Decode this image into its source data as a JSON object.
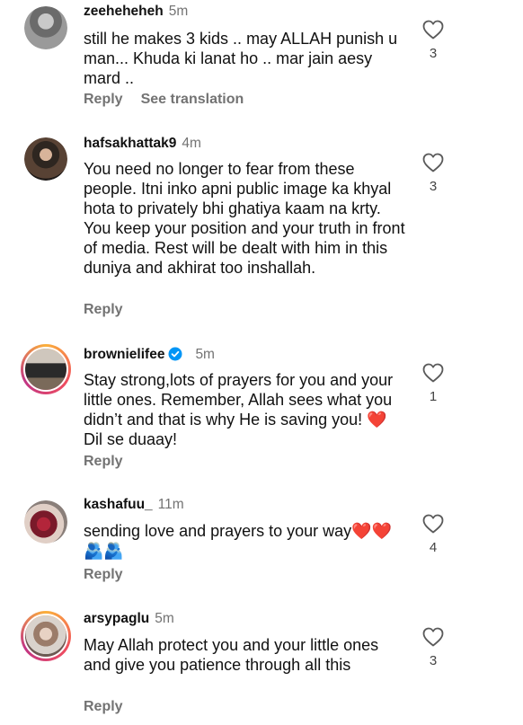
{
  "comments": [
    {
      "username": "zeeheheheh",
      "time": "5m",
      "text": "still he makes 3 kids .. may ALLAH punish u man... Khuda ki lanat ho .. mar jain aesy mard ..",
      "reply_label": "Reply",
      "translation_label": "See translation",
      "likes": "3"
    },
    {
      "username": "hafsakhattak9",
      "time": "4m",
      "text": "You need no longer to fear from these people. Itni inko apni public image ka khyal hota to privately bhi ghatiya kaam na krty. You keep your position and your truth in front of media. Rest will be dealt with him in this duniya and akhirat too inshallah.",
      "reply_label": "Reply",
      "likes": "3"
    },
    {
      "username": "brownielifee",
      "time": "5m",
      "text": "Stay strong,lots of prayers for you and your little ones. Remember, Allah sees what you didn’t and that is why He is saving you! ❤️ Dil se duaay!",
      "reply_label": "Reply",
      "likes": "1",
      "verified": true
    },
    {
      "username": "kashafuu_",
      "time": "11m",
      "text": "sending love and prayers to your way❤️❤️🫂🫂",
      "reply_label": "Reply",
      "likes": "4"
    },
    {
      "username": "arsypaglu",
      "time": "5m",
      "text": "May Allah protect you and your little ones and give you patience through all this",
      "reply_label": "Reply",
      "likes": "3"
    }
  ],
  "icons": {
    "like": "heart-outline-icon",
    "verified": "verified-badge-icon"
  },
  "colors": {
    "secondary_text": "#737373",
    "verified_blue": "#0095f6",
    "story_ring_start": "#fbb03b",
    "story_ring_end": "#c13584"
  }
}
